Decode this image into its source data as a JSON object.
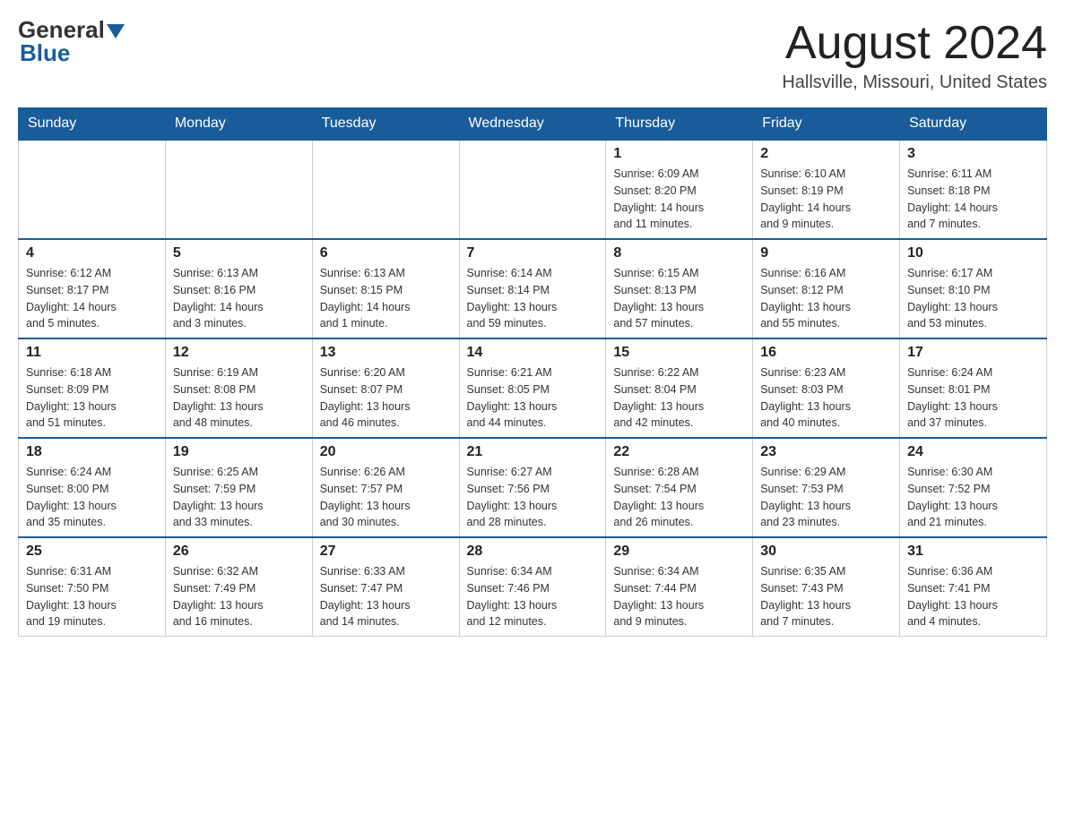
{
  "header": {
    "logo_general": "General",
    "logo_blue": "Blue",
    "main_title": "August 2024",
    "subtitle": "Hallsville, Missouri, United States"
  },
  "days_of_week": [
    "Sunday",
    "Monday",
    "Tuesday",
    "Wednesday",
    "Thursday",
    "Friday",
    "Saturday"
  ],
  "weeks": [
    [
      {
        "day": "",
        "info": ""
      },
      {
        "day": "",
        "info": ""
      },
      {
        "day": "",
        "info": ""
      },
      {
        "day": "",
        "info": ""
      },
      {
        "day": "1",
        "info": "Sunrise: 6:09 AM\nSunset: 8:20 PM\nDaylight: 14 hours\nand 11 minutes."
      },
      {
        "day": "2",
        "info": "Sunrise: 6:10 AM\nSunset: 8:19 PM\nDaylight: 14 hours\nand 9 minutes."
      },
      {
        "day": "3",
        "info": "Sunrise: 6:11 AM\nSunset: 8:18 PM\nDaylight: 14 hours\nand 7 minutes."
      }
    ],
    [
      {
        "day": "4",
        "info": "Sunrise: 6:12 AM\nSunset: 8:17 PM\nDaylight: 14 hours\nand 5 minutes."
      },
      {
        "day": "5",
        "info": "Sunrise: 6:13 AM\nSunset: 8:16 PM\nDaylight: 14 hours\nand 3 minutes."
      },
      {
        "day": "6",
        "info": "Sunrise: 6:13 AM\nSunset: 8:15 PM\nDaylight: 14 hours\nand 1 minute."
      },
      {
        "day": "7",
        "info": "Sunrise: 6:14 AM\nSunset: 8:14 PM\nDaylight: 13 hours\nand 59 minutes."
      },
      {
        "day": "8",
        "info": "Sunrise: 6:15 AM\nSunset: 8:13 PM\nDaylight: 13 hours\nand 57 minutes."
      },
      {
        "day": "9",
        "info": "Sunrise: 6:16 AM\nSunset: 8:12 PM\nDaylight: 13 hours\nand 55 minutes."
      },
      {
        "day": "10",
        "info": "Sunrise: 6:17 AM\nSunset: 8:10 PM\nDaylight: 13 hours\nand 53 minutes."
      }
    ],
    [
      {
        "day": "11",
        "info": "Sunrise: 6:18 AM\nSunset: 8:09 PM\nDaylight: 13 hours\nand 51 minutes."
      },
      {
        "day": "12",
        "info": "Sunrise: 6:19 AM\nSunset: 8:08 PM\nDaylight: 13 hours\nand 48 minutes."
      },
      {
        "day": "13",
        "info": "Sunrise: 6:20 AM\nSunset: 8:07 PM\nDaylight: 13 hours\nand 46 minutes."
      },
      {
        "day": "14",
        "info": "Sunrise: 6:21 AM\nSunset: 8:05 PM\nDaylight: 13 hours\nand 44 minutes."
      },
      {
        "day": "15",
        "info": "Sunrise: 6:22 AM\nSunset: 8:04 PM\nDaylight: 13 hours\nand 42 minutes."
      },
      {
        "day": "16",
        "info": "Sunrise: 6:23 AM\nSunset: 8:03 PM\nDaylight: 13 hours\nand 40 minutes."
      },
      {
        "day": "17",
        "info": "Sunrise: 6:24 AM\nSunset: 8:01 PM\nDaylight: 13 hours\nand 37 minutes."
      }
    ],
    [
      {
        "day": "18",
        "info": "Sunrise: 6:24 AM\nSunset: 8:00 PM\nDaylight: 13 hours\nand 35 minutes."
      },
      {
        "day": "19",
        "info": "Sunrise: 6:25 AM\nSunset: 7:59 PM\nDaylight: 13 hours\nand 33 minutes."
      },
      {
        "day": "20",
        "info": "Sunrise: 6:26 AM\nSunset: 7:57 PM\nDaylight: 13 hours\nand 30 minutes."
      },
      {
        "day": "21",
        "info": "Sunrise: 6:27 AM\nSunset: 7:56 PM\nDaylight: 13 hours\nand 28 minutes."
      },
      {
        "day": "22",
        "info": "Sunrise: 6:28 AM\nSunset: 7:54 PM\nDaylight: 13 hours\nand 26 minutes."
      },
      {
        "day": "23",
        "info": "Sunrise: 6:29 AM\nSunset: 7:53 PM\nDaylight: 13 hours\nand 23 minutes."
      },
      {
        "day": "24",
        "info": "Sunrise: 6:30 AM\nSunset: 7:52 PM\nDaylight: 13 hours\nand 21 minutes."
      }
    ],
    [
      {
        "day": "25",
        "info": "Sunrise: 6:31 AM\nSunset: 7:50 PM\nDaylight: 13 hours\nand 19 minutes."
      },
      {
        "day": "26",
        "info": "Sunrise: 6:32 AM\nSunset: 7:49 PM\nDaylight: 13 hours\nand 16 minutes."
      },
      {
        "day": "27",
        "info": "Sunrise: 6:33 AM\nSunset: 7:47 PM\nDaylight: 13 hours\nand 14 minutes."
      },
      {
        "day": "28",
        "info": "Sunrise: 6:34 AM\nSunset: 7:46 PM\nDaylight: 13 hours\nand 12 minutes."
      },
      {
        "day": "29",
        "info": "Sunrise: 6:34 AM\nSunset: 7:44 PM\nDaylight: 13 hours\nand 9 minutes."
      },
      {
        "day": "30",
        "info": "Sunrise: 6:35 AM\nSunset: 7:43 PM\nDaylight: 13 hours\nand 7 minutes."
      },
      {
        "day": "31",
        "info": "Sunrise: 6:36 AM\nSunset: 7:41 PM\nDaylight: 13 hours\nand 4 minutes."
      }
    ]
  ]
}
